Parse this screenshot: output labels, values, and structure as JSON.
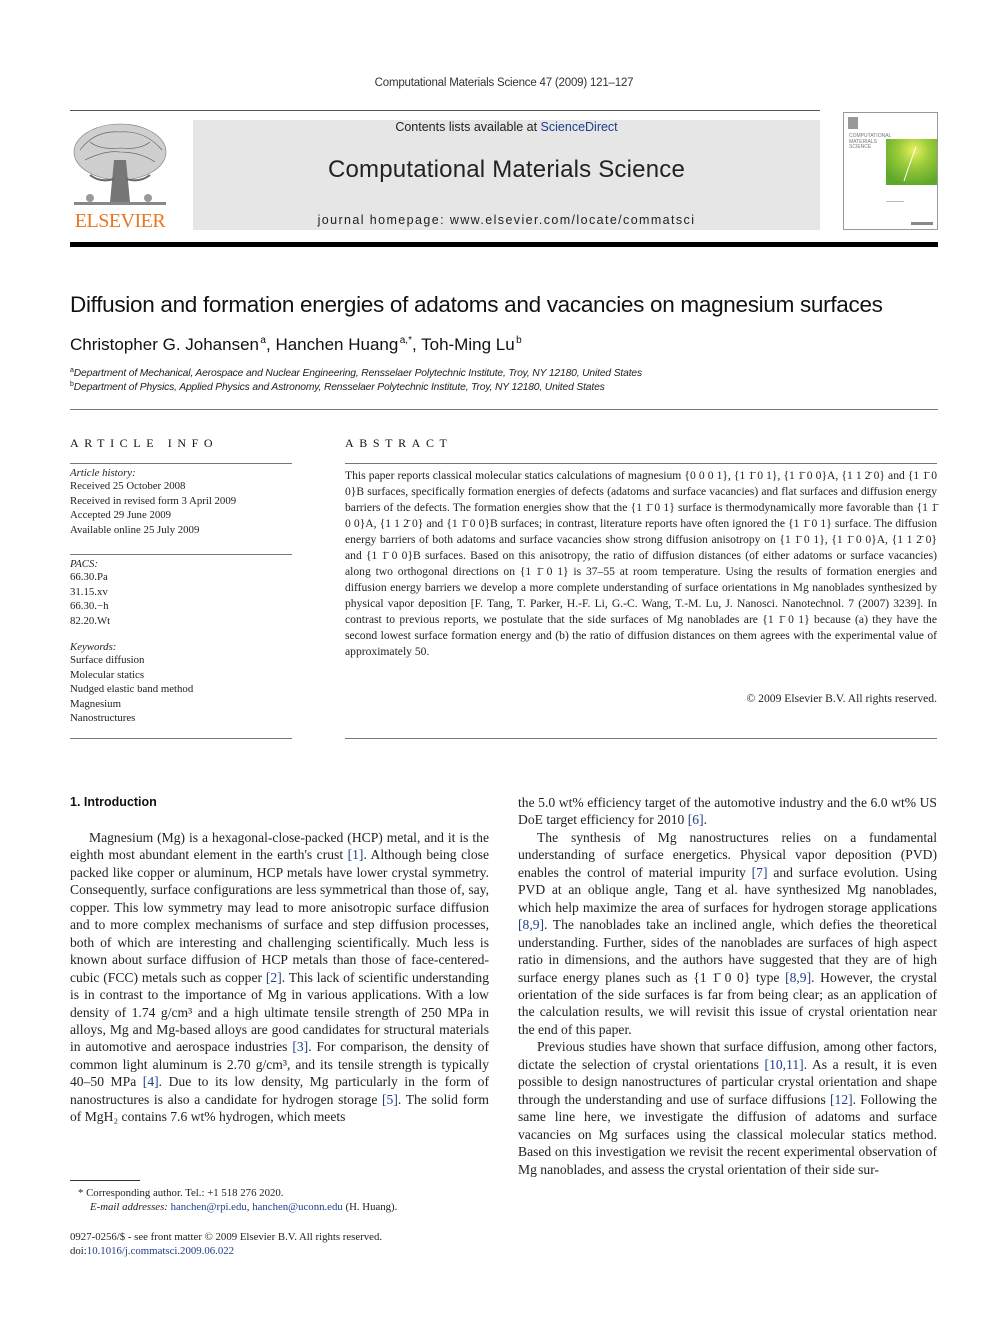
{
  "running_head": "Computational Materials Science 47 (2009) 121–127",
  "masthead": {
    "contents_prefix": "Contents lists available at ",
    "contents_link": "ScienceDirect",
    "journal_title": "Computational Materials Science",
    "homepage": "journal homepage: www.elsevier.com/locate/commatsci",
    "publisher_logo_text": "ELSEVIER",
    "cover_title_lines": [
      "COMPUTATIONAL",
      "MATERIALS",
      "SCIENCE"
    ]
  },
  "colors": {
    "elsevier_orange": "#e87722",
    "link_blue": "#1f3d8a",
    "masthead_gray": "#e6e6e6",
    "cover_green": "#6bb52a"
  },
  "article": {
    "title": "Diffusion and formation energies of adatoms and vacancies on magnesium surfaces",
    "authors": [
      {
        "name": "Christopher G. Johansen",
        "sup": "a"
      },
      {
        "name": "Hanchen Huang",
        "sup": "a,*"
      },
      {
        "name": "Toh-Ming Lu",
        "sup": "b"
      }
    ],
    "affiliations": [
      {
        "mark": "a",
        "text": "Department of Mechanical, Aerospace and Nuclear Engineering, Rensselaer Polytechnic Institute, Troy, NY 12180, United States"
      },
      {
        "mark": "b",
        "text": "Department of Physics, Applied Physics and Astronomy, Rensselaer Polytechnic Institute, Troy, NY 12180, United States"
      }
    ]
  },
  "article_info": {
    "heading": "ARTICLE INFO",
    "history_label": "Article history:",
    "history": [
      "Received 25 October 2008",
      "Received in revised form 3 April 2009",
      "Accepted 29 June 2009",
      "Available online 25 July 2009"
    ],
    "pacs_label": "PACS:",
    "pacs": [
      "66.30.Pa",
      "31.15.xv",
      "66.30.−h",
      "82.20.Wt"
    ],
    "keywords_label": "Keywords:",
    "keywords": [
      "Surface diffusion",
      "Molecular statics",
      "Nudged elastic band method",
      "Magnesium",
      "Nanostructures"
    ]
  },
  "abstract": {
    "heading": "ABSTRACT",
    "text": "This paper reports classical molecular statics calculations of magnesium {0 0 0 1}, {1 1̄ 0 1}, {1 1̄ 0 0}A, {1 1 2̄ 0} and {1 1̄ 0 0}B surfaces, specifically formation energies of defects (adatoms and surface vacancies) and flat surfaces and diffusion energy barriers of the defects. The formation energies show that the {1 1̄ 0 1} surface is thermodynamically more favorable than {1 1̄ 0 0}A, {1 1 2̄ 0} and {1 1̄ 0 0}B surfaces; in contrast, literature reports have often ignored the {1 1̄ 0 1} surface. The diffusion energy barriers of both adatoms and surface vacancies show strong diffusion anisotropy on {1 1̄ 0 1}, {1 1̄ 0 0}A, {1 1 2̄ 0} and {1 1̄ 0 0}B surfaces. Based on this anisotropy, the ratio of diffusion distances (of either adatoms or surface vacancies) along two orthogonal directions on {1 1̄ 0 1} is 37–55 at room temperature. Using the results of formation energies and diffusion energy barriers we develop a more complete understanding of surface orientations in Mg nanoblades synthesized by physical vapor deposition [F. Tang, T. Parker, H.-F. Li, G.-C. Wang, T.-M. Lu, J. Nanosci. Nanotechnol. 7 (2007) 3239]. In contrast to previous reports, we postulate that the side surfaces of Mg nanoblades are {1 1̄ 0 1} because (a) they have the second lowest surface formation energy and (b) the ratio of diffusion distances on them agrees with the experimental value of approximately 50.",
    "copyright": "© 2009 Elsevier B.V. All rights reserved."
  },
  "introduction": {
    "heading": "1. Introduction",
    "left_column": [
      {
        "segments": [
          {
            "t": "Magnesium (Mg) is a hexagonal-close-packed (HCP) metal, and it is the eighth most abundant element in the earth's crust "
          },
          {
            "t": "[1]",
            "link": true
          },
          {
            "t": ". Although being close packed like copper or aluminum, HCP metals have lower crystal symmetry. Consequently, surface configurations are less symmetrical than those of, say, copper. This low symmetry may lead to more anisotropic surface diffusion and to more complex mechanisms of surface and step diffusion processes, both of which are interesting and challenging scientifically. Much less is known about surface diffusion of HCP metals than those of face-centered-cubic (FCC) metals such as copper "
          },
          {
            "t": "[2]",
            "link": true
          },
          {
            "t": ". This lack of scientific understanding is in contrast to the importance of Mg in various applications. With a low density of 1.74 g/cm³ and a high ultimate tensile strength of 250 MPa in alloys, Mg and Mg-based alloys are good candidates for structural materials in automotive and aerospace industries "
          },
          {
            "t": "[3]",
            "link": true
          },
          {
            "t": ". For comparison, the density of common light aluminum is 2.70 g/cm³, and its tensile strength is typically 40–50 MPa "
          },
          {
            "t": "[4]",
            "link": true
          },
          {
            "t": ". Due to its low density, Mg particularly in the form of nanostructures is also a candidate for hydrogen storage "
          },
          {
            "t": "[5]",
            "link": true
          },
          {
            "t": ". The solid form of MgH₂ contains 7.6 wt% hydrogen, which meets"
          }
        ]
      }
    ],
    "right_column": [
      {
        "indent": false,
        "segments": [
          {
            "t": "the 5.0 wt% efficiency target of the automotive industry and the 6.0 wt% US DoE target efficiency for 2010 "
          },
          {
            "t": "[6]",
            "link": true
          },
          {
            "t": "."
          }
        ]
      },
      {
        "indent": true,
        "segments": [
          {
            "t": "The synthesis of Mg nanostructures relies on a fundamental understanding of surface energetics. Physical vapor deposition (PVD) enables the control of material impurity "
          },
          {
            "t": "[7]",
            "link": true
          },
          {
            "t": " and surface evolution. Using PVD at an oblique angle, Tang et al. have synthesized Mg nanoblades, which help maximize the area of surfaces for hydrogen storage applications "
          },
          {
            "t": "[8,9]",
            "link": true
          },
          {
            "t": ". The nanoblades take an inclined angle, which defies the theoretical understanding. Further, sides of the nanoblades are surfaces of high aspect ratio in dimensions, and the authors have suggested that they are of high surface energy planes such as {1 1̄ 0 0} type "
          },
          {
            "t": "[8,9]",
            "link": true
          },
          {
            "t": ". However, the crystal orientation of the side surfaces is far from being clear; as an application of the calculation results, we will revisit this issue of crystal orientation near the end of this paper."
          }
        ]
      },
      {
        "indent": true,
        "segments": [
          {
            "t": "Previous studies have shown that surface diffusion, among other factors, dictate the selection of crystal orientations "
          },
          {
            "t": "[10,11]",
            "link": true
          },
          {
            "t": ". As a result, it is even possible to design nanostructures of particular crystal orientation and shape through the understanding and use of surface diffusions "
          },
          {
            "t": "[12]",
            "link": true
          },
          {
            "t": ". Following the same line here, we investigate the diffusion of adatoms and surface vacancies on Mg surfaces using the classical molecular statics method. Based on this investigation we revisit the recent experimental observation of Mg nanoblades, and assess the crystal orientation of their side sur-"
          }
        ]
      }
    ]
  },
  "footnotes": {
    "corresponding": "*  Corresponding author. Tel.: +1 518 276 2020.",
    "email_label": "E-mail addresses:",
    "emails": [
      "hanchen@rpi.edu",
      "hanchen@uconn.edu"
    ],
    "email_suffix": " (H. Huang).",
    "front_matter": "0927-0256/$ - see front matter © 2009 Elsevier B.V. All rights reserved.",
    "doi_prefix": "doi:",
    "doi": "10.1016/j.commatsci.2009.06.022"
  }
}
